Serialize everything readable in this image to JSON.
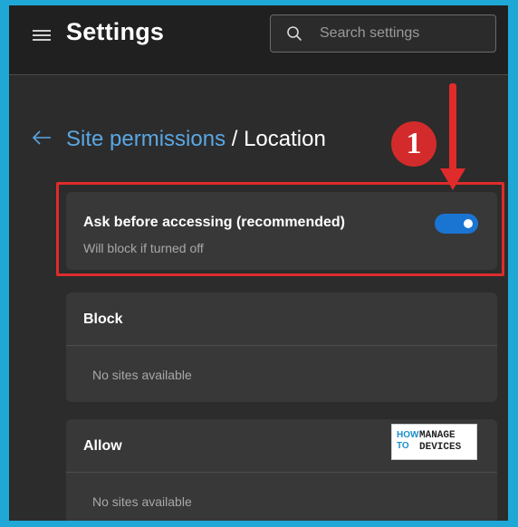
{
  "header": {
    "title": "Settings",
    "search_placeholder": "Search settings"
  },
  "breadcrumb": {
    "parent": "Site permissions",
    "separator": "/",
    "current": "Location"
  },
  "ask_card": {
    "title": "Ask before accessing (recommended)",
    "subtitle": "Will block if turned off",
    "toggle_on": true
  },
  "block_section": {
    "title": "Block",
    "empty_text": "No sites available"
  },
  "allow_section": {
    "title": "Allow",
    "empty_text": "No sites available"
  },
  "annotation": {
    "badge_number": "1",
    "color": "#e02b2b"
  },
  "watermark": {
    "line1": "HOW",
    "line2": "TO",
    "line3": "MANAGE",
    "line4": "DEVICES"
  },
  "colors": {
    "accent": "#1a74d2",
    "link": "#5aa7e3",
    "background": "#202020",
    "card": "#383838",
    "border": "#1fa7d6"
  }
}
